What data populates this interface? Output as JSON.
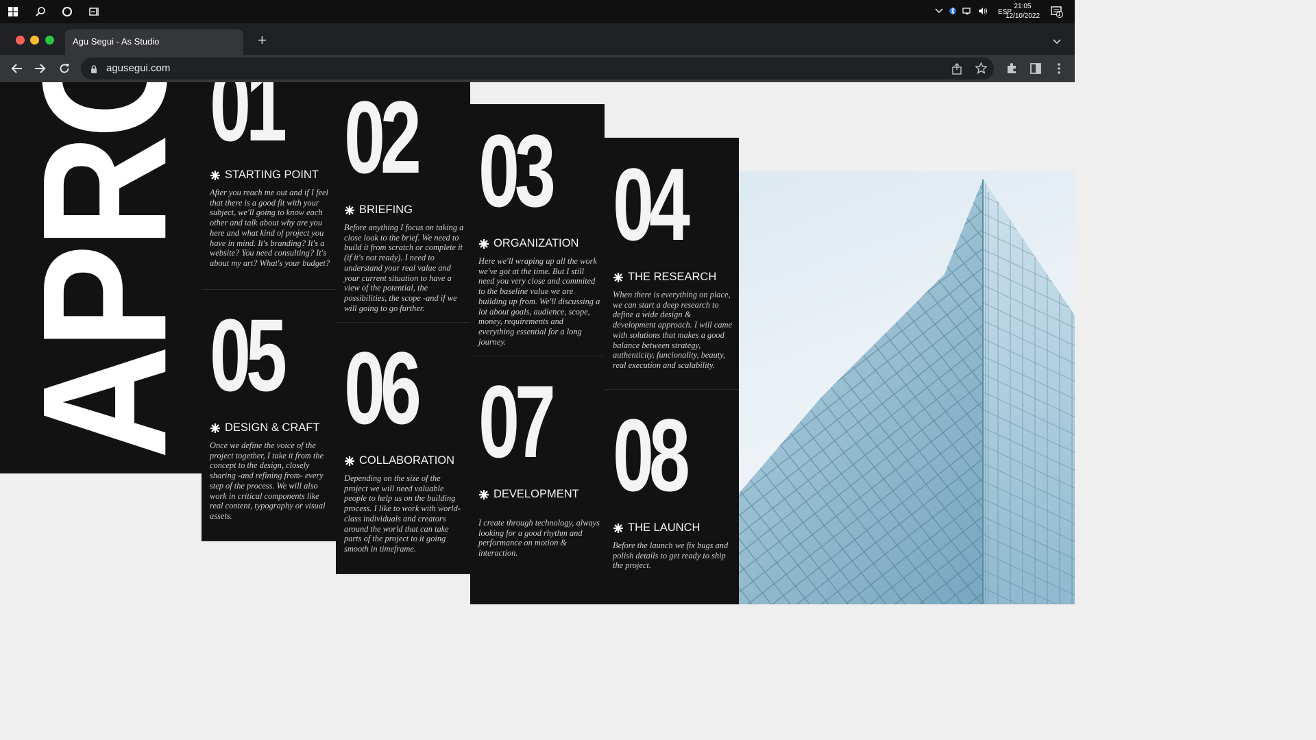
{
  "taskbar": {
    "language": "ESP",
    "time": "21:05",
    "date": "12/10/2022",
    "notification_count": "1"
  },
  "browser": {
    "tab_title": "Agu Segui - As Studio",
    "new_tab": "+",
    "url": "agusegui.com",
    "traffic_light_colors": [
      "#ff5f57",
      "#febc2e",
      "#28c840"
    ]
  },
  "page": {
    "vertical_word": "APROCES",
    "steps": [
      {
        "number": "01",
        "title": "STARTING POINT",
        "description": "After you reach me out and if I feel that there is a good fit with your subject, we'll going to know each other and talk about why are you here and what kind of project you have in mind. It's branding? It's a website? You need consulting? It's about my art? What's your budget?"
      },
      {
        "number": "02",
        "title": "BRIEFING",
        "description": "Before anything I focus on taking a close look to the brief. We need to build it from scratch or complete it (if it's not ready). I need to understand your real value and your current situation to have a view of the potential, the possibilities, the scope -and if we will going to go further."
      },
      {
        "number": "03",
        "title": "ORGANIZATION",
        "description": "Here we'll wraping up all the work we've got at the time. But I still need you very close and commited to the baseline value we are building up from. We'll discussing a lot about goals, audience, scope, money, requirements and everything essential for a long journey."
      },
      {
        "number": "04",
        "title": "THE RESEARCH",
        "description": "When there is everything on place, we can start a deep research to define a wide design & development approach. I will came with solutions that makes a good balance between strategy, authenticity, funcionality, beauty, real execution and scalability."
      },
      {
        "number": "05",
        "title": "DESIGN & CRAFT",
        "description": "Once we define the voice of the project together, I take it from the concept to the design, closely sharing -and refining from- every step of the process. We will also work in critical components like real content, typography or visual assets."
      },
      {
        "number": "06",
        "title": "COLLABORATION",
        "description": "Depending on the size of the project we will need valuable people to help us on the building process. I like to work with world-class individuals and creators around the world that can take parts of the project to it going smooth in timeframe."
      },
      {
        "number": "07",
        "title": "DEVELOPMENT",
        "description": "I create through technology, always looking for a good rhythm and performance on motion & interaction."
      },
      {
        "number": "08",
        "title": "THE LAUNCH",
        "description": "Before the launch we fix bugs and polish details to get ready to ship the project."
      }
    ]
  }
}
